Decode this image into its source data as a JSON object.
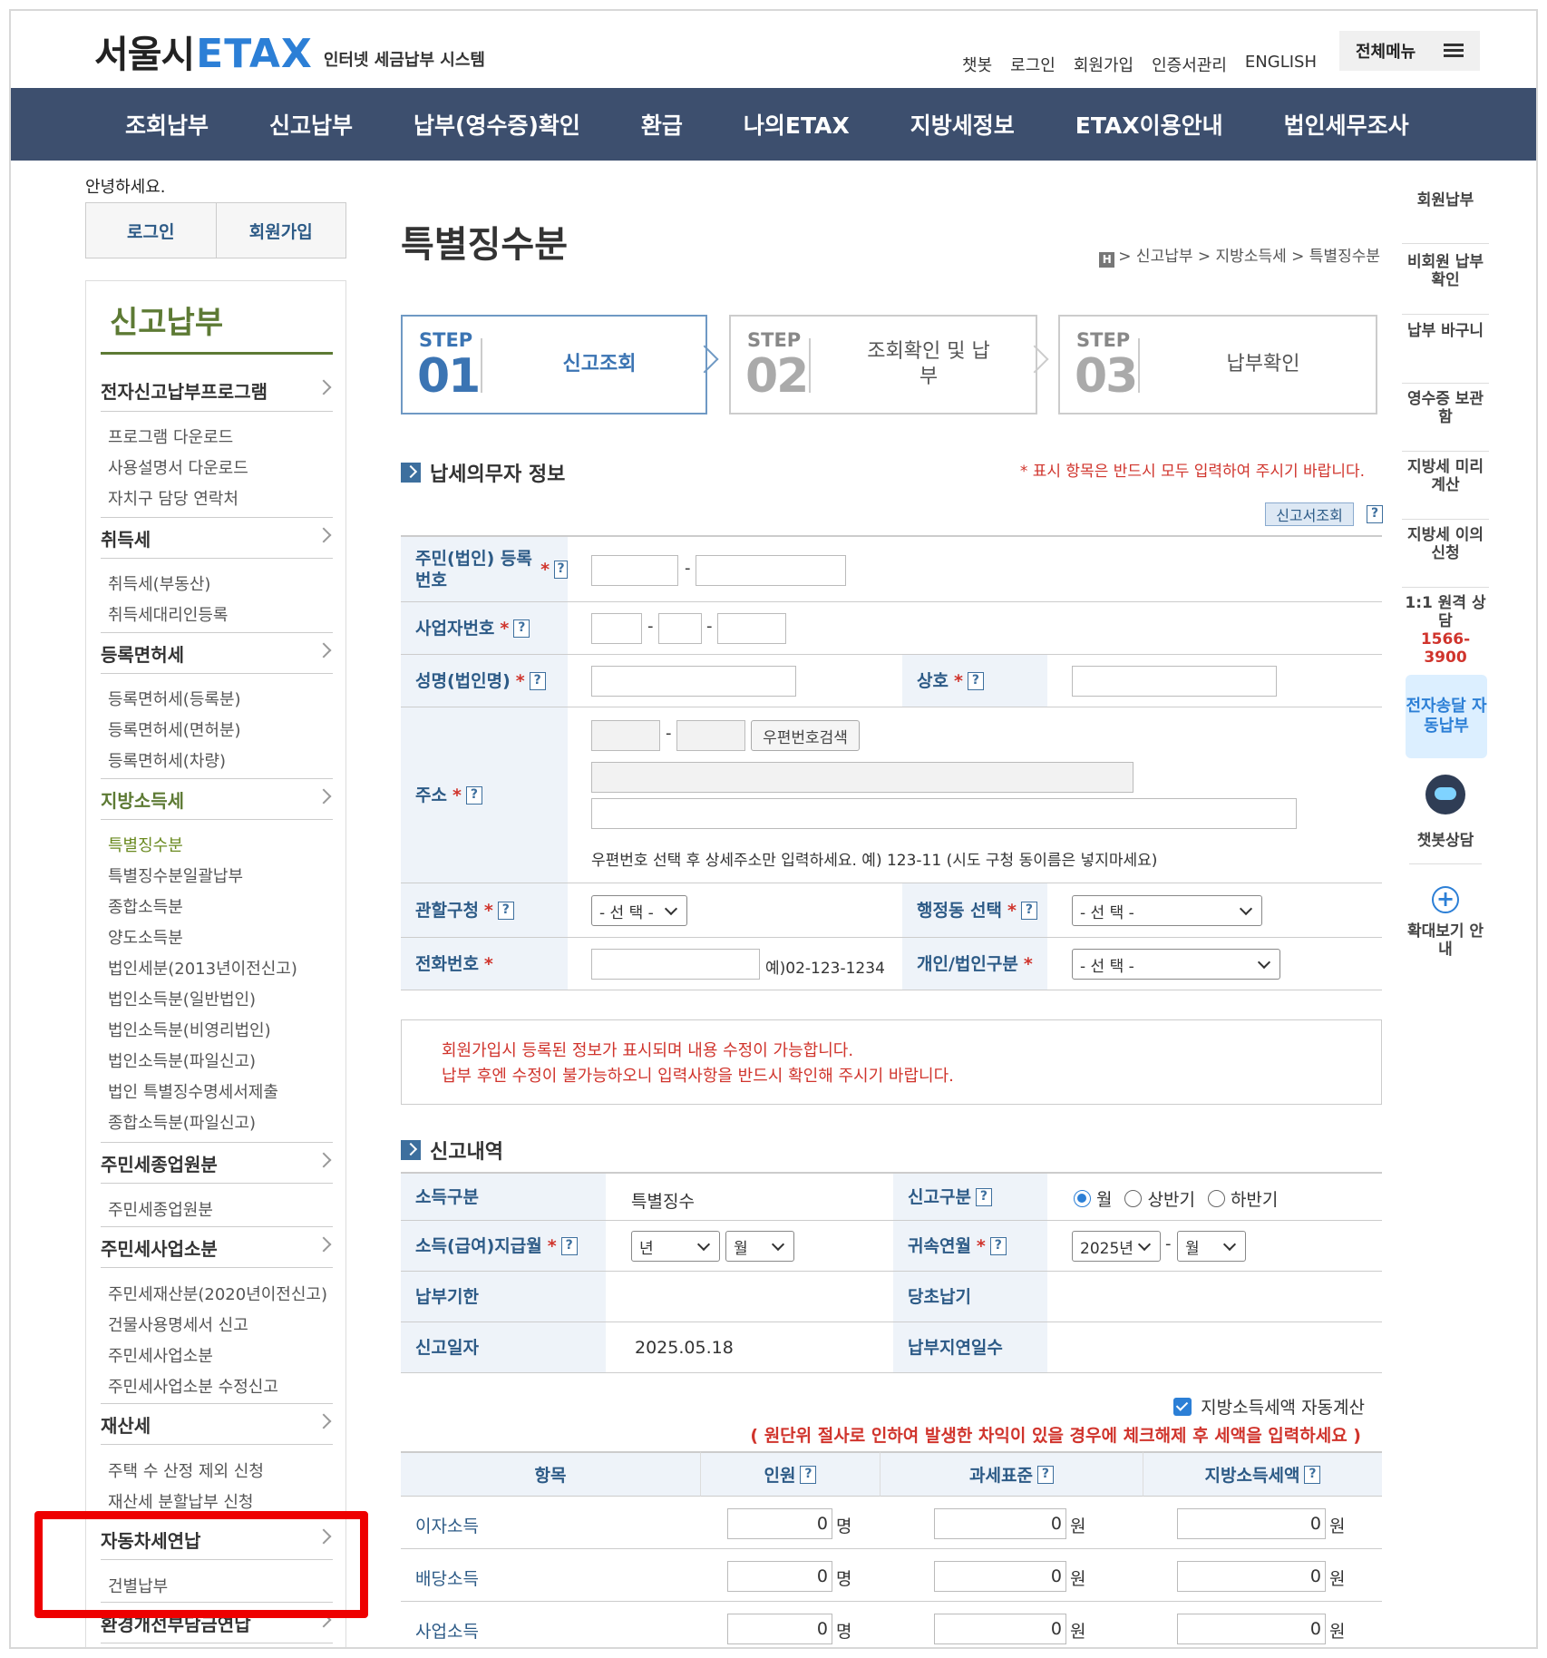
{
  "header": {
    "logo_city": "서울시",
    "logo_brand": "ETAX",
    "logo_sub": "인터넷 세금납부 시스템",
    "util": [
      "챗봇",
      "로그인",
      "회원가입",
      "인증서관리",
      "ENGLISH"
    ],
    "all_menu": "전체메뉴"
  },
  "gnb": [
    "조회납부",
    "신고납부",
    "납부(영수증)확인",
    "환급",
    "나의ETAX",
    "지방세정보",
    "ETAX이용안내",
    "법인세무조사"
  ],
  "left": {
    "hello": "안녕하세요.",
    "login": "로그인",
    "join": "회원가입",
    "title": "신고납부",
    "cats": [
      "전자신고납부프로그램",
      "취득세",
      "등록면허세",
      "지방소득세",
      "주민세종업원분",
      "주민세사업소분",
      "재산세",
      "자동차세연납",
      "환경개선부담금연납"
    ],
    "subs": {
      "prog": [
        "프로그램 다운로드",
        "사용설명서 다운로드",
        "자치구 담당 연락처"
      ],
      "acq": [
        "취득세(부동산)",
        "취득세대리인등록"
      ],
      "reg": [
        "등록면허세(등록분)",
        "등록면허세(면허분)",
        "등록면허세(차량)"
      ],
      "local": [
        "특별징수분",
        "특별징수분일괄납부",
        "종합소득분",
        "양도소득분",
        "법인세분(2013년이전신고)",
        "법인소득분(일반법인)",
        "법인소득분(비영리법인)",
        "법인소득분(파일신고)",
        "법인 특별징수명세서제출",
        "종합소득분(파일신고)"
      ],
      "emp": [
        "주민세종업원분"
      ],
      "biz": [
        "주민세재산분(2020년이전신고)",
        "건물사용명세서 신고",
        "주민세사업소분",
        "주민세사업소분 수정신고"
      ],
      "prop": [
        "주택 수 산정 제외 신청",
        "재산세 분할납부 신청"
      ],
      "car": [
        "건별납부"
      ]
    }
  },
  "page": {
    "title": "특별징수분",
    "crumb_home": "H",
    "crumb": "> 신고납부 > 지방소득세 > 특별징수분"
  },
  "steps": [
    {
      "label": "STEP",
      "num": "01",
      "text": "신고조회"
    },
    {
      "label": "STEP",
      "num": "02",
      "text": "조회확인 및 납부"
    },
    {
      "label": "STEP",
      "num": "03",
      "text": "납부확인"
    }
  ],
  "taxpayer": {
    "title": "납세의무자 정보",
    "required_note": "* 표시 항목은 반드시 모두 입력하여 주시기 바랍니다.",
    "lookup_btn": "신고서조회",
    "rrn": "주민(법인) 등록번호",
    "bizno": "사업자번호",
    "name": "성명(법인명)",
    "trade": "상호",
    "addr": "주소",
    "zip_btn": "우편번호검색",
    "addr_hint": "우편번호 선택 후 상세주소만 입력하세요. 예) 123-11 (시도 구청 동이름은 넣지마세요)",
    "district": "관할구청",
    "dong": "행정동 선택",
    "phone": "전화번호",
    "phone_hint": "예)02-123-1234",
    "ptype": "개인/법인구분",
    "select": "- 선 택 -"
  },
  "notice": [
    "회원가입시 등록된 정보가 표시되며 내용 수정이 가능합니다.",
    "납부 후엔 수정이 불가능하오니 입력사항을 반드시 확인해 주시기 바랍니다."
  ],
  "report": {
    "title": "신고내역",
    "income_type": "소득구분",
    "income_type_val": "특별징수",
    "report_type": "신고구분",
    "radios": [
      "월",
      "상반기",
      "하반기"
    ],
    "pay_month": "소득(급여)지급월",
    "year_sel": "년",
    "month_sel": "월",
    "attr_month": "귀속연월",
    "attr_year_val": "2025년",
    "due": "납부기한",
    "orig_due": "당초납기",
    "rep_date": "신고일자",
    "rep_date_val": "2025.05.18",
    "late_days": "납부지연일수",
    "autocalc": "지방소득세액 자동계산",
    "warn": "( 원단위 절사로 인하여 발생한 차익이 있을 경우에 체크해제 후 세액을 입력하세요 )",
    "cols": [
      "항목",
      "인원",
      "과세표준",
      "지방소득세액"
    ],
    "rows": [
      {
        "name": "이자소득",
        "p": "0",
        "b": "0",
        "t": "0"
      },
      {
        "name": "배당소득",
        "p": "0",
        "b": "0",
        "t": "0"
      },
      {
        "name": "사업소득",
        "p": "0",
        "b": "0",
        "t": "0"
      }
    ],
    "unit_person": "명",
    "unit_won": "원"
  },
  "quick": {
    "items": [
      "회원납부",
      "비회원 납부확인",
      "납부 바구니",
      "영수증 보관함",
      "지방세 미리계산",
      "지방세 이의신청",
      "1:1 원격 상담"
    ],
    "phone": "1566-3900",
    "edoc": "전자송달 자동납부",
    "bot": "챗봇상담",
    "zoom": "확대보기 안내"
  },
  "colors": {
    "gnb": "#3d4f6e",
    "brand": "#2c7fd6",
    "accent_green": "#5d7a34",
    "required": "#d0342c",
    "highlight": "#e00000"
  }
}
